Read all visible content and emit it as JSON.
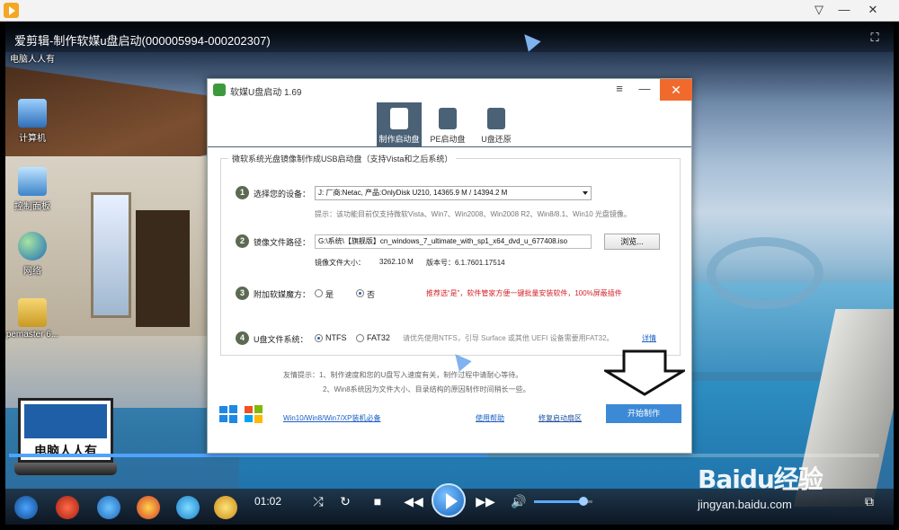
{
  "player": {
    "title": "爱剪辑-制作软媒u盘启动(000005994-000202307)",
    "time": "01:02",
    "progress": 0.55,
    "volume": 0.85
  },
  "desktop_icons": [
    {
      "label": "电脑人人有"
    },
    {
      "label": "计算机"
    },
    {
      "label": "控制面板"
    },
    {
      "label": "网络"
    },
    {
      "label": "pemaster 6..."
    }
  ],
  "laptop_brand": "电脑人人有",
  "watermark": {
    "logo": "Baidu经验",
    "url": "jingyan.baidu.com"
  },
  "dialog": {
    "title": "软媒U盘启动 1.69",
    "tabs": [
      {
        "label": "制作启动盘"
      },
      {
        "label": "PE启动盘"
      },
      {
        "label": "U盘还原"
      }
    ],
    "group_title": "微软系统光盘镜像制作成USB启动盘（支持Vista和之后系统）",
    "step1": {
      "num": "1",
      "label": "选择您的设备：",
      "device": "J: 厂商:Netac, 产品:OnlyDisk U210,  14365.9 M / 14394.2 M"
    },
    "step2": {
      "num": "2",
      "label": "镜像文件路径：",
      "hint": "提示：该功能目前仅支持微软Vista、Win7、Win2008、Win2008 R2、Win8/8.1、Win10 光盘镜像。",
      "path": "G:\\系统\\【旗舰版】cn_windows_7_ultimate_with_sp1_x64_dvd_u_677408.iso",
      "browse": "浏览...",
      "size_label": "镜像文件大小：",
      "size_value": "3262.10 M",
      "version": "版本号：6.1.7601.17514"
    },
    "step3": {
      "num": "3",
      "label": "附加软媒魔方：",
      "yes": "是",
      "no": "否",
      "note": "推荐选“是”，软件管家方便一键批量安装软件，100%屏蔽插件"
    },
    "step4": {
      "num": "4",
      "label": "U盘文件系统：",
      "ntfs": "NTFS",
      "fat32": "FAT32",
      "note": "请优先使用NTFS，引导 Surface 或其他 UEFI 设备需要用FAT32。",
      "link": "详情"
    },
    "tips": {
      "line1": "友情提示：1、制作速度和您的U盘写入速度有关，制作过程中请耐心等待。",
      "line2": "2、Win8系统因为文件大小、目录结构的原因制作时间稍长一些。"
    },
    "footer": {
      "install_link": "Win10/Win8/Win7/XP装机必备",
      "help_link": "使用帮助",
      "repair_link": "修复启动扇区",
      "start": "开始制作"
    }
  },
  "colors": {
    "accent": "#3c8ad6",
    "close": "#f06a2e",
    "tab_active": "#4a6176",
    "warn": "#d2232a"
  }
}
